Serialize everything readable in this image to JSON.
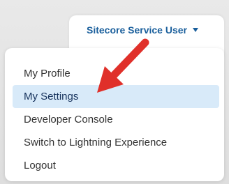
{
  "user_menu": {
    "user_name": "Sitecore Service User",
    "caret_icon": "caret-down-icon",
    "accent_color": "#1a5f9c"
  },
  "menu": {
    "items": [
      {
        "label": "My Profile"
      },
      {
        "label": "My Settings"
      },
      {
        "label": "Developer Console"
      },
      {
        "label": "Switch to Lightning Experience"
      },
      {
        "label": "Logout"
      }
    ],
    "highlighted_item": "My Settings",
    "highlight_color": "#d8eaf9"
  },
  "annotation": {
    "icon": "red-arrow-icon",
    "color": "#e0302a"
  }
}
